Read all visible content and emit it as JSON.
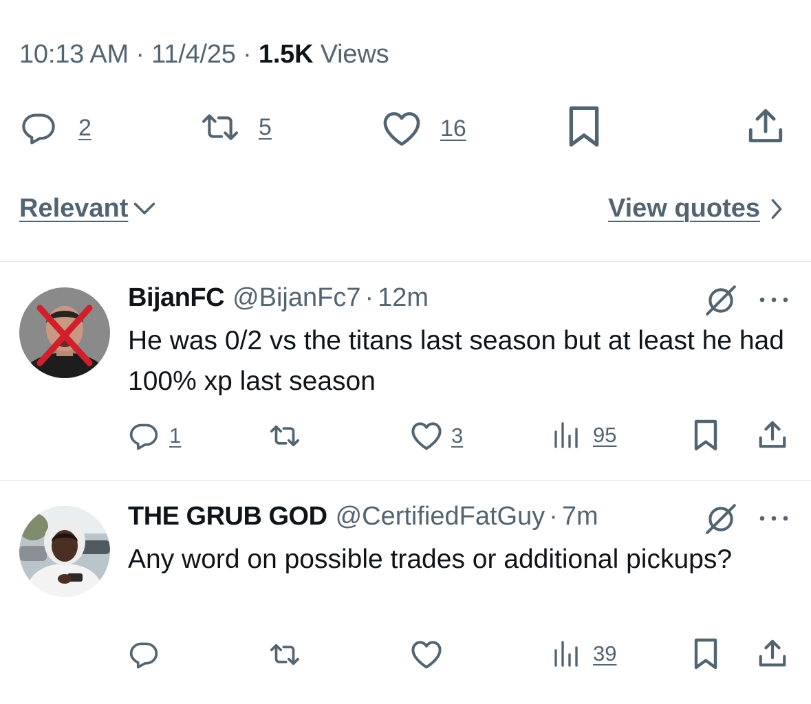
{
  "tweet_meta": {
    "time": "10:13 AM",
    "date": "11/4/25",
    "views_count": "1.5K",
    "views_label": "Views"
  },
  "main_actions": {
    "replies": "2",
    "reposts": "5",
    "likes": "16"
  },
  "sort_label": "Relevant",
  "view_quotes_label": "View quotes",
  "replies": [
    {
      "name": "BijanFC",
      "handle": "@BijanFc7",
      "time": "12m",
      "text": "He was 0/2 vs the titans last season but at least he had 100% xp last season",
      "reply_count": "1",
      "like_count": "3",
      "view_count": "95"
    },
    {
      "name": "THE GRUB GOD",
      "handle": "@CertifiedFatGuy",
      "time": "7m",
      "text": "Any word on possible trades or additional pickups?",
      "view_count": "39"
    }
  ],
  "colors": {
    "text_primary": "#0f1419",
    "text_secondary": "#536471",
    "divider": "#dfe3e6"
  },
  "icons": [
    "reply-icon",
    "repost-icon",
    "like-icon",
    "bookmark-icon",
    "share-icon",
    "views-icon",
    "grok-icon",
    "more-icon",
    "chevron-down-icon",
    "chevron-right-icon"
  ]
}
